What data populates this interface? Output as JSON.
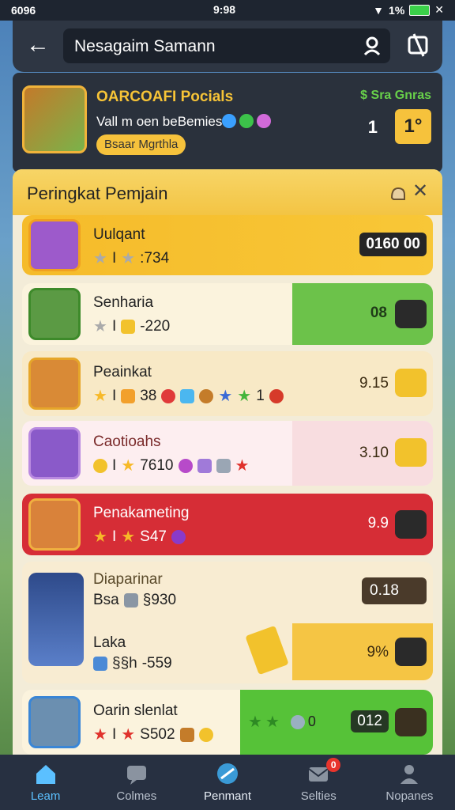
{
  "status": {
    "carrier": "6096",
    "time": "9:98",
    "battery": "1%"
  },
  "top": {
    "search_value": "Nesagaim Samann"
  },
  "profile": {
    "name": "OARCOAFI Pocials",
    "subtitle": "Vall m oen beBemies",
    "badge": "Bsaar Mgrthla",
    "currency": "$ Sra Gnras",
    "level_label": "1",
    "level_value": "1°"
  },
  "leaderboard": {
    "title": "Peringkat Pemjain",
    "rows": [
      {
        "name": "Uulqant",
        "stats": ":734",
        "score": "0160 00"
      },
      {
        "name": "Senharia",
        "stats": "-220",
        "score": "08"
      },
      {
        "name": "Peainkat",
        "stats": "38",
        "stats_extra": "1",
        "score": "9.15"
      },
      {
        "name": "Caotioahs",
        "stats": "7610",
        "score": "3.10"
      },
      {
        "name": "Penakameting",
        "stats": "S47",
        "score": "9.9"
      },
      {
        "name": "Diaparinar",
        "stats_label": "Bsa",
        "stats": "§930",
        "score": "0.18"
      },
      {
        "name": "Laka",
        "stats_label": "§§h",
        "stats": "-559",
        "score": "9%"
      },
      {
        "name": "Oarin slenlat",
        "stats": "S502",
        "stats_extra": "0",
        "score": "012"
      }
    ]
  },
  "nav": [
    {
      "label": "Leam"
    },
    {
      "label": "Colmes"
    },
    {
      "label": "Penmant"
    },
    {
      "label": "Selties",
      "badge": "0"
    },
    {
      "label": "Nopanes"
    }
  ],
  "colors": {
    "accent_yellow": "#f6c23c",
    "accent_green": "#6cc24a",
    "accent_red": "#d62d36",
    "nav_active": "#5bc0ff"
  }
}
